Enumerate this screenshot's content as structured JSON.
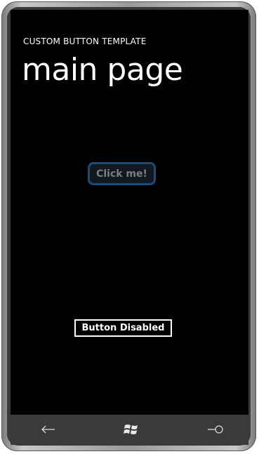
{
  "app": {
    "title": "CUSTOM BUTTON TEMPLATE",
    "page_title": "main page"
  },
  "content": {
    "click_button_label": "Click me!",
    "disable_button_label": "Button Disabled"
  },
  "navbar": {
    "back_icon": "back-arrow-icon",
    "start_icon": "windows-logo-icon",
    "search_icon": "search-icon"
  },
  "colors": {
    "screen_background": "#000000",
    "accent_border": "#1b4c78",
    "disabled_text": "#7d7d7d",
    "navbar_background": "#3a3a3a"
  }
}
